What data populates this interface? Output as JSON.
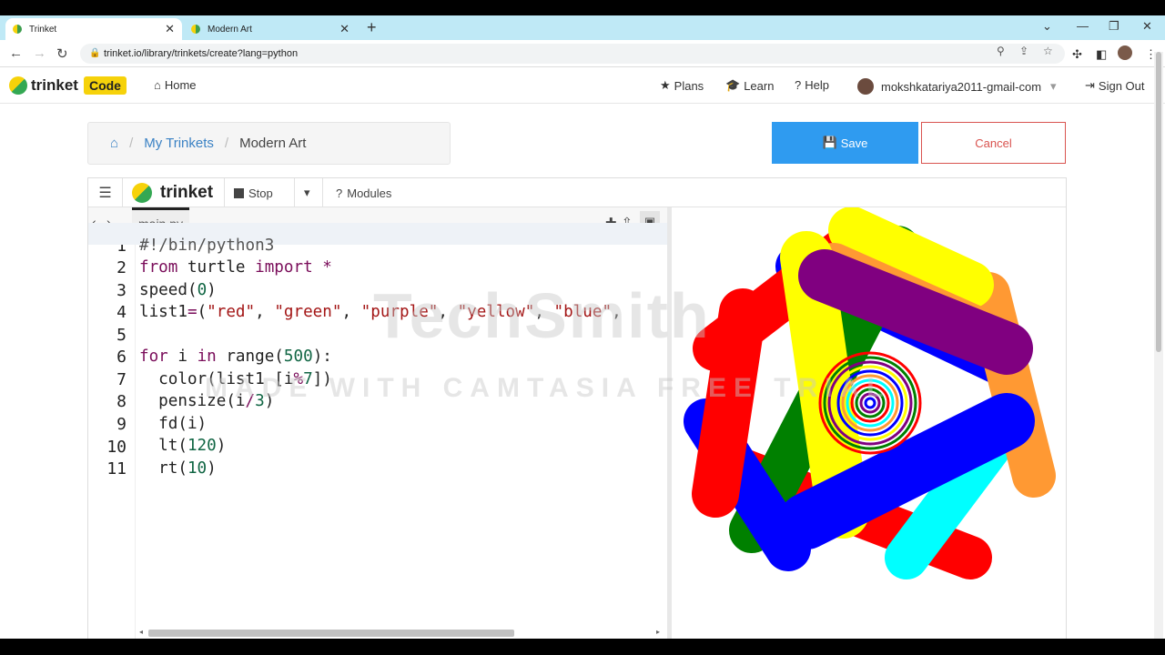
{
  "browser": {
    "tabs": [
      {
        "title": "Trinket",
        "active": true
      },
      {
        "title": "Modern Art",
        "active": false
      }
    ],
    "url": "trinket.io/library/trinkets/create?lang=python"
  },
  "header": {
    "logo_text": "trinket",
    "badge": "Code",
    "home": "Home",
    "plans": "Plans",
    "learn": "Learn",
    "help": "Help",
    "user": "mokshkatariya2011-gmail-com",
    "sign_out": "Sign Out"
  },
  "breadcrumb": {
    "my_trinkets": "My Trinkets",
    "current": "Modern Art"
  },
  "actions": {
    "save": "Save",
    "cancel": "Cancel"
  },
  "toolbar": {
    "logo": "trinket",
    "stop": "Stop",
    "modules": "Modules"
  },
  "editor": {
    "file": "main.py",
    "line_numbers": [
      "1",
      "2",
      "3",
      "4",
      "5",
      "6",
      "7",
      "8",
      "9",
      "10",
      "11"
    ]
  },
  "watermark": {
    "brand": "TechSmith",
    "trial": "MADE WITH CAMTASIA FREE TRIAL"
  },
  "colors": {
    "save": "#2f9bf0",
    "cancel": "#d9534f",
    "tabstrip": "#bfe9f6",
    "badge": "#f6d20a"
  }
}
